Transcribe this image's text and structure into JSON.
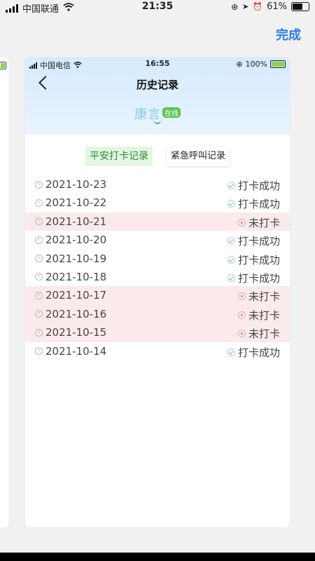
{
  "os_status": {
    "carrier": "中国联通",
    "time": "21:35",
    "battery": "61%"
  },
  "done_label": "完成",
  "inner_status": {
    "carrier": "中国电信",
    "time": "16:55",
    "battery": "100%"
  },
  "page_title": "历史记录",
  "person": {
    "name": "康言",
    "status": "在线"
  },
  "tabs": [
    {
      "label": "平安打卡记录",
      "active": true
    },
    {
      "label": "紧急呼叫记录",
      "active": false
    }
  ],
  "records": [
    {
      "date": "2021-10-23",
      "status": "打卡成功",
      "ok": true
    },
    {
      "date": "2021-10-22",
      "status": "打卡成功",
      "ok": true
    },
    {
      "date": "2021-10-21",
      "status": "未打卡",
      "ok": false
    },
    {
      "date": "2021-10-20",
      "status": "打卡成功",
      "ok": true
    },
    {
      "date": "2021-10-19",
      "status": "打卡成功",
      "ok": true
    },
    {
      "date": "2021-10-18",
      "status": "打卡成功",
      "ok": true
    },
    {
      "date": "2021-10-17",
      "status": "未打卡",
      "ok": false
    },
    {
      "date": "2021-10-16",
      "status": "未打卡",
      "ok": false
    },
    {
      "date": "2021-10-15",
      "status": "未打卡",
      "ok": false
    },
    {
      "date": "2021-10-14",
      "status": "打卡成功",
      "ok": true
    }
  ],
  "colors": {
    "accent": "#2b7de9",
    "success": "#2c8b38",
    "missed_row": "#fbeaea"
  }
}
